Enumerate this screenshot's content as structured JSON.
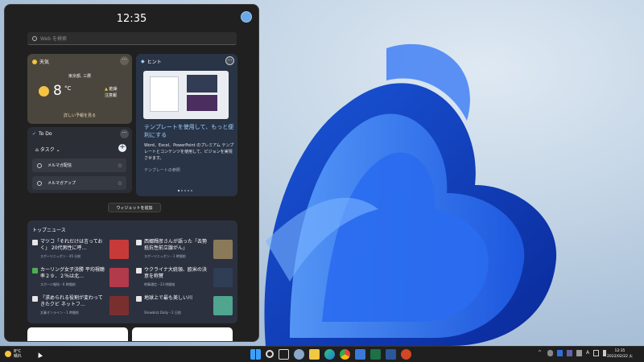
{
  "panel": {
    "clock": "12:35",
    "search_placeholder": "Web を検索"
  },
  "weather": {
    "title": "天気",
    "location": "東京都, 三鷹",
    "temperature": "8",
    "unit": "°C",
    "condition_line1": "乾燥",
    "condition_line2": "注意報",
    "link": "詳しい予報を見る"
  },
  "hint": {
    "title": "ヒント",
    "heading": "テンプレートを使用して、もっと便利にする",
    "body": "Word、Excel、PowerPoint のプレミアム テンプレートとコンテンツを使用して、ビジョンを実現させます。",
    "link": "テンプレートの参照"
  },
  "todo": {
    "title": "To Do",
    "list_label": "タスク",
    "items": [
      {
        "label": "メルマガ配信"
      },
      {
        "label": "メルマガアップ"
      }
    ]
  },
  "add_widget_label": "ウィジェットを追加",
  "news": {
    "title": "トップニュース",
    "stories": [
      {
        "headline": "マツコ「それだけは言っておく」 20代男性に呼…",
        "meta": "スポーツニッポン・45 分前",
        "badge_color": "#e6e6e6",
        "thumb_color": "#c83a3a"
      },
      {
        "headline": "西郷輝彦さんが語った「去勢抵抗性前立腺がん」",
        "meta": "スポーツニッポン・1 時間前",
        "badge_color": "#e6e6e6",
        "thumb_color": "#8a7a5a"
      },
      {
        "headline": "カーリング女子決勝 平均視聴率２９．２％は北…",
        "meta": "スポーツ報知・6 時間前",
        "badge_color": "#4caf50",
        "thumb_color": "#b33a4a"
      },
      {
        "headline": "ウクライナ大統領、欧米の決意を称賛",
        "meta": "時事通信・23 時間前",
        "badge_color": "#e6e6e6",
        "thumb_color": "#2f3d55"
      },
      {
        "headline": "「求められる役割が変わってきたクビ ネットフ…",
        "meta": "文春オンライン・1 時間前",
        "badge_color": "#e6e6e6",
        "thumb_color": "#7a2f2f"
      },
      {
        "headline": "地球上で最も美しい川",
        "meta": "Showbizz Daily・2 日前",
        "badge_color": "#e6e6e6",
        "thumb_color": "#4fa58e"
      }
    ]
  },
  "taskbar": {
    "weather_temp": "8°C",
    "weather_cond": "晴れ",
    "tray_ime": "A",
    "time": "12:35",
    "date": "2022/02/22 火"
  },
  "colors": {
    "panel_bg": "#202020",
    "hint_heading": "#9fd0ff",
    "accent": "#0078d4"
  }
}
